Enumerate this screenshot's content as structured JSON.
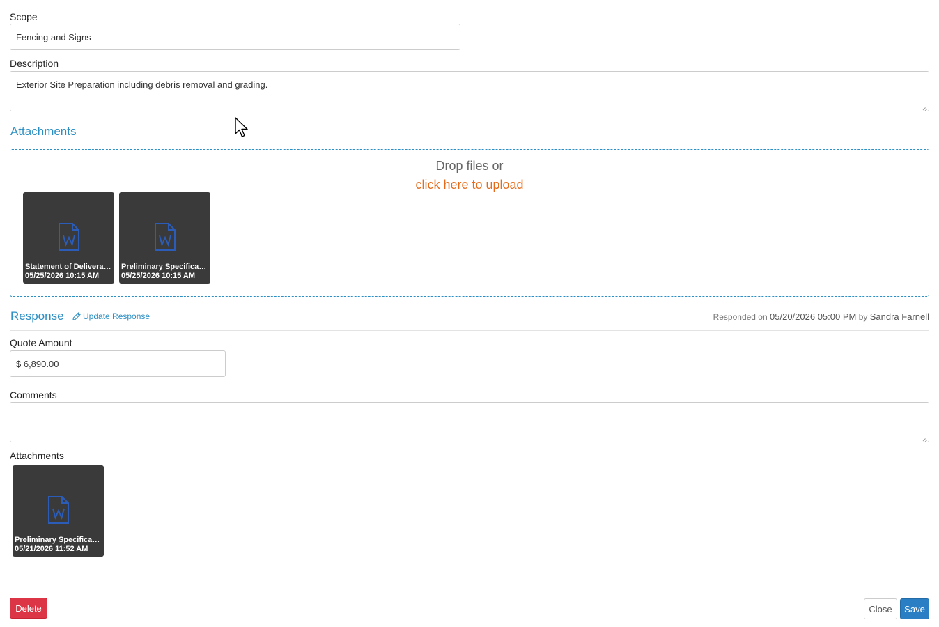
{
  "scope": {
    "label": "Scope",
    "value": "Fencing and Signs"
  },
  "description": {
    "label": "Description",
    "value": "Exterior Site Preparation including debris removal and grading."
  },
  "attachments": {
    "title": "Attachments",
    "dropzone_text": "Drop files or",
    "dropzone_link": "click here to upload",
    "files": [
      {
        "name": "Statement of Deliverables",
        "date": "05/25/2026 10:15 AM",
        "icon": "word-file-icon"
      },
      {
        "name": "Preliminary Specifications",
        "date": "05/25/2026 10:15 AM",
        "icon": "word-file-icon"
      }
    ]
  },
  "response": {
    "title": "Response",
    "update_label": "Update Response",
    "responded_prefix": "Responded on",
    "responded_date": "05/20/2026 05:00 PM",
    "responded_by_word": "by",
    "responded_by": "Sandra Farnell",
    "quote_label": "Quote Amount",
    "quote_value": "$ 6,890.00",
    "comments_label": "Comments",
    "comments_value": "",
    "attachments_label": "Attachments",
    "files": [
      {
        "name": "Preliminary Specifications",
        "date": "05/21/2026 11:52 AM",
        "icon": "word-file-icon"
      }
    ]
  },
  "footer": {
    "delete_label": "Delete",
    "close_label": "Close",
    "save_label": "Save"
  },
  "colors": {
    "accent": "#2c8fc4",
    "upload_link": "#e56b1a",
    "delete": "#dc3545",
    "save": "#2a7fc4",
    "tile_bg": "#3a3a3a",
    "word_icon": "#2b5cb8"
  }
}
